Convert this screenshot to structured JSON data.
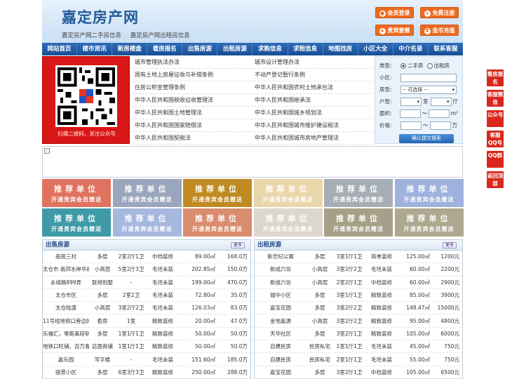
{
  "header": {
    "logo": "嘉定房产网",
    "sub_links": [
      "嘉定房产网二手房信息",
      "嘉定房产网出租房信息"
    ],
    "buttons": [
      {
        "label": "会员登录",
        "icon": "user-icon"
      },
      {
        "label": "免费注册",
        "icon": "register-icon"
      },
      {
        "label": "贵宾套餐",
        "icon": "vip-icon"
      },
      {
        "label": "金币充值",
        "icon": "coin-icon"
      }
    ]
  },
  "nav": [
    "网站首页",
    "楼市资讯",
    "新房楼盘",
    "看房报名",
    "出售房源",
    "出租房源",
    "求购信息",
    "求租信息",
    "地图找房",
    "小区大全",
    "中介名录",
    "联系客服"
  ],
  "qr": {
    "caption": "扫描二维码，关注公众号"
  },
  "links": [
    [
      "城市管理执法办法",
      "城市设计管理办法"
    ],
    [
      "国有土地上房屋征收与补偿条例",
      "不动产登记暂行条例"
    ],
    [
      "住房公积金管理条例",
      "中华人民共和国农村土地承包法"
    ],
    [
      "中华人民共和国税收征收管理法",
      "中华人民共和国继承法"
    ],
    [
      "中华人民共和国土地管理法",
      "中华人民共和国城乡规划法"
    ],
    [
      "中华人民共和国国家赔偿法",
      "中华人民共和国城市维护建设税法"
    ],
    [
      "中华人民共和国契税法",
      "中华人民共和国城市房地产管理法"
    ]
  ],
  "search": {
    "type_label": "类型:",
    "type_options": [
      "二手房",
      "出租房"
    ],
    "community_label": "小区:",
    "house_type_label": "房型:",
    "house_type_value": "-- 可选择 --",
    "layout_label": "户型:",
    "room_unit": "室",
    "hall_unit": "厅",
    "area_label": "面积:",
    "area_unit": "m²",
    "price_label": "价格:",
    "price_unit": "万",
    "range_sep": "〜",
    "submit": "确认提交搜索"
  },
  "ads": {
    "title": "推荐单位",
    "subtitle": "开通贵宾会员赠送",
    "colors": [
      "#e0735f",
      "#9aa6bd",
      "#c08a22",
      "#ead6ab",
      "#a6aeb5",
      "#9eb2dd",
      "#3f9aa8",
      "#a7b8df",
      "#d98c6e",
      "#ddd6cc",
      "#a7a088",
      "#aea890"
    ]
  },
  "sell": {
    "title": "出售房源",
    "more": "更多",
    "rows": [
      [
        "南苑三村",
        "多层",
        "2室2厅1卫",
        "中档装修",
        "89.00㎡",
        "168.0万"
      ],
      [
        "太仓市 南郊水岸华府",
        "小高层",
        "5室2厅3卫",
        "毛坯未装",
        "202.85㎡",
        "150.0万"
      ],
      [
        "永靖路899弄",
        "联排别墅",
        "-",
        "毛坯未装",
        "199.00㎡",
        "470.0万"
      ],
      [
        "太仓市区",
        "多层",
        "2室2卫",
        "毛坯未装",
        "72.80㎡",
        "35.0万"
      ],
      [
        "太仓陆渡",
        "小高层",
        "3室2厅2卫",
        "毛坯未装",
        "126.03㎡",
        "83.0万"
      ],
      [
        "11号线地铁口旁边的",
        "套房",
        "1室",
        "精致装修",
        "20.00㎡",
        "47.0万"
      ],
      [
        "乐福汇，零距离轻轨交",
        "多层",
        "1室1厅1卫",
        "精致装修",
        "50.00㎡",
        "50.0万"
      ],
      [
        "地铁口旺铺，百万客流",
        "店面商铺",
        "1室1厅1卫",
        "精致装修",
        "50.00㎡",
        "50.0万"
      ],
      [
        "嘉乐园",
        "写字楼",
        "-",
        "毛坯未装",
        "151.60㎡",
        "185.0万"
      ],
      [
        "丽景小区",
        "多层",
        "6室3厅3卫",
        "精致装修",
        "250.00㎡",
        "288.0万"
      ]
    ]
  },
  "rent": {
    "title": "出租房源",
    "more": "更多",
    "rows": [
      [
        "新世纪公寓",
        "多层",
        "3室1厅1卫",
        "简单装修",
        "125.00㎡",
        "1200元"
      ],
      [
        "新成六坊",
        "小高层",
        "3室2厅2卫",
        "毛坯未装",
        "60.00㎡",
        "2200元"
      ],
      [
        "新成六坊",
        "小高层",
        "2室2厅1卫",
        "中档装修",
        "60.00㎡",
        "2900元"
      ],
      [
        "城中小区",
        "多层",
        "3室1厅1卫",
        "精致装修",
        "85.00㎡",
        "3900元"
      ],
      [
        "嘉宝花园",
        "多层",
        "3室2厅2卫",
        "精致装修",
        "148.47㎡",
        "15000元"
      ],
      [
        "金地嘉源",
        "小高层",
        "3室2厅2卫",
        "精致装修",
        "95.00㎡",
        "4800元"
      ],
      [
        "天华社区",
        "多层",
        "3室2厅1卫",
        "精致装修",
        "105.00㎡",
        "6000元"
      ],
      [
        "自建民房",
        "民房私宅",
        "1室1厅1卫",
        "毛坯未装",
        "45.00㎡",
        "750元"
      ],
      [
        "自建民房",
        "民房私宅",
        "2室1厅1卫",
        "毛坯未装",
        "55.00㎡",
        "750元"
      ],
      [
        "嘉宝花园",
        "多层",
        "3室2厅1卫",
        "中档装修",
        "105.00㎡",
        "6500元"
      ]
    ]
  },
  "side": [
    "看房报名",
    "客服微信",
    "公众号",
    "客服QQ号",
    "QQ群",
    "返回顶部"
  ]
}
